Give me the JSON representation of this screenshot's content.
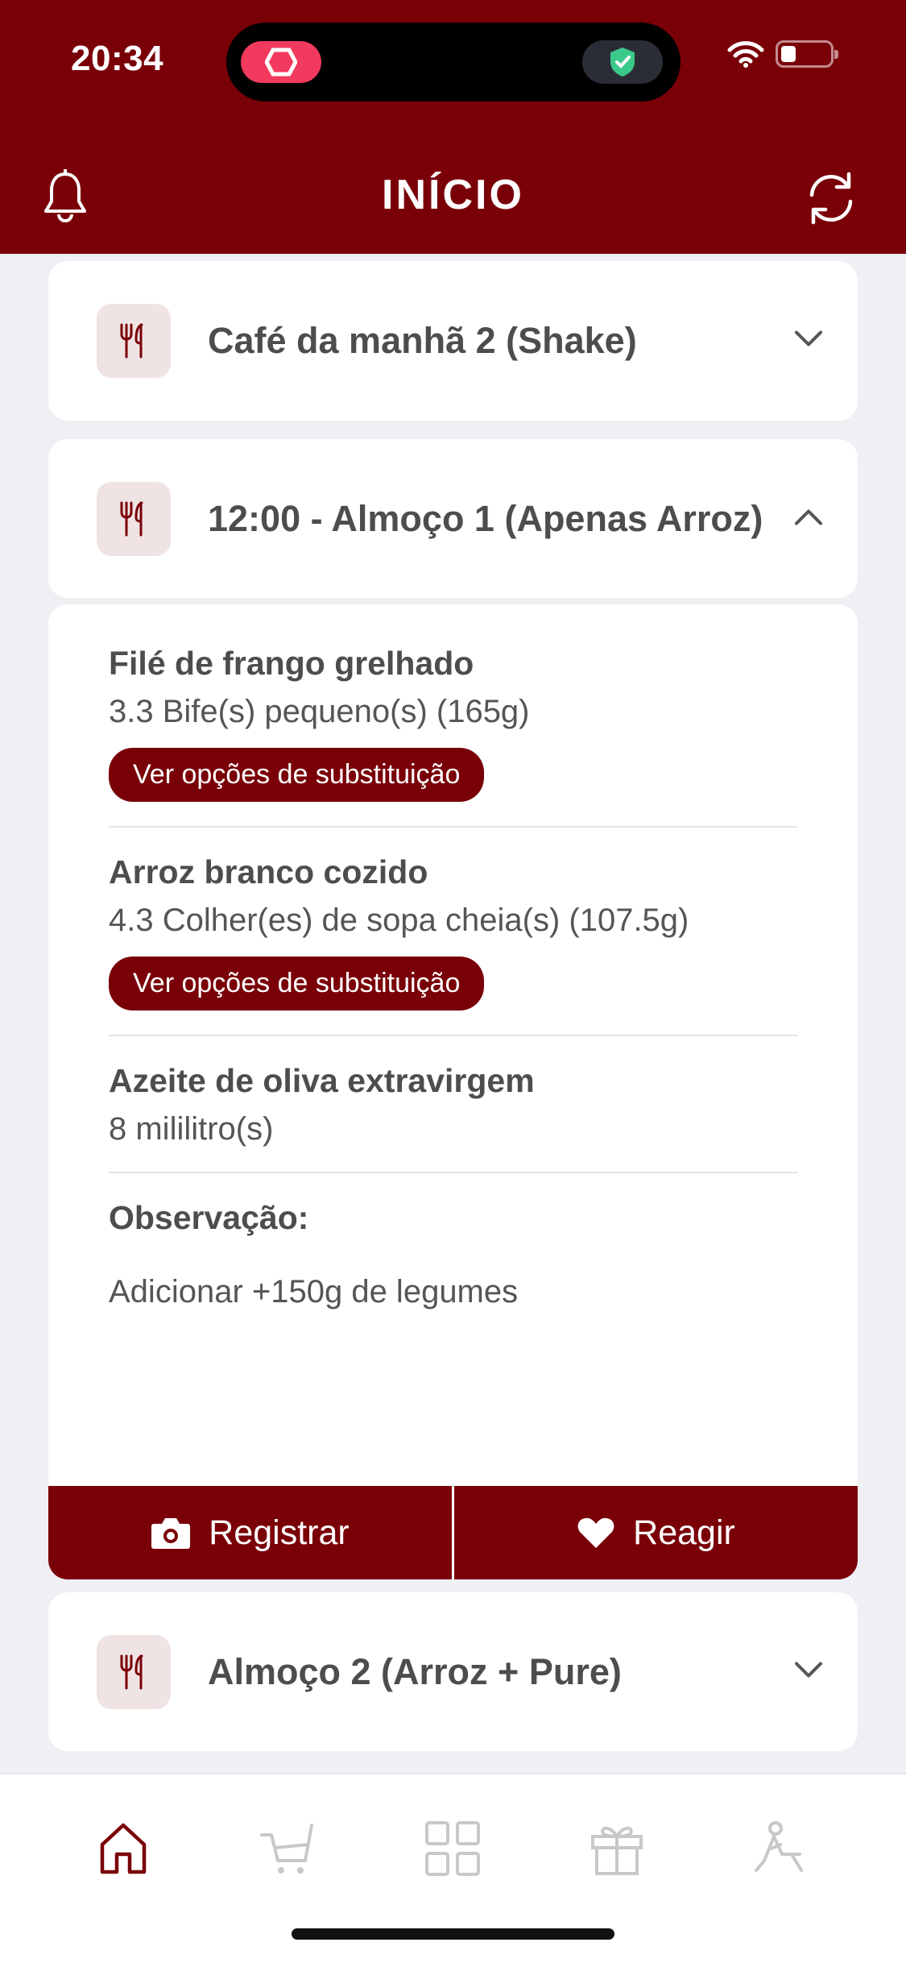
{
  "status_bar": {
    "time": "20:34"
  },
  "header": {
    "title": "INÍCIO"
  },
  "meals": [
    {
      "title": "Café da manhã 2 (Shake)",
      "expanded": false
    },
    {
      "title": "12:00 - Almoço 1 (Apenas Arroz)",
      "expanded": true
    },
    {
      "title": "Almoço 2 (Arroz + Pure)",
      "expanded": false
    }
  ],
  "foods": [
    {
      "name": "Filé de frango grelhado",
      "quantity": "3.3 Bife(s) pequeno(s) (165g)",
      "substitution_label": "Ver opções de substituição"
    },
    {
      "name": "Arroz branco cozido",
      "quantity": "4.3 Colher(es) de sopa cheia(s) (107.5g)",
      "substitution_label": "Ver opções de substituição"
    },
    {
      "name": "Azeite de oliva extravirgem",
      "quantity": "8 mililitro(s)"
    }
  ],
  "observation": {
    "label": "Observação:",
    "text": "Adicionar +150g de legumes"
  },
  "actions": {
    "register": "Registrar",
    "react": "Reagir"
  },
  "tabs": [
    {
      "icon": "home-icon",
      "active": true
    },
    {
      "icon": "cart-icon",
      "active": false
    },
    {
      "icon": "grid-icon",
      "active": false
    },
    {
      "icon": "gift-icon",
      "active": false
    },
    {
      "icon": "exercise-icon",
      "active": false
    }
  ],
  "colors": {
    "brand": "#7a0008",
    "background": "#efeff4",
    "icon_bg": "#f0e3e3",
    "inactive_icon": "#c8c8c8"
  }
}
